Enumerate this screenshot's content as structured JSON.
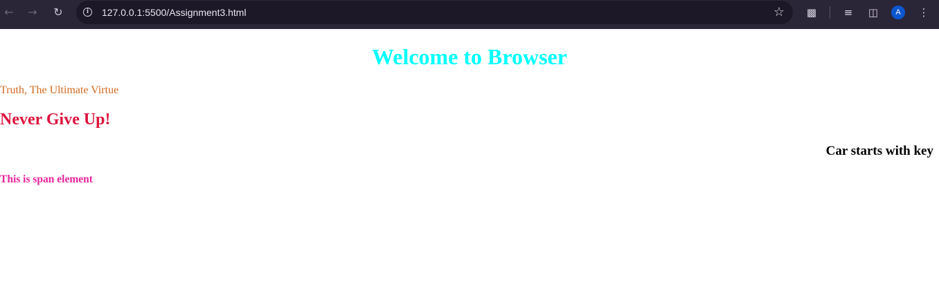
{
  "browser": {
    "url": "127.0.0.1:5500/Assignment3.html",
    "avatar_initial": "A",
    "icons": {
      "back": "back-arrow-icon",
      "forward": "forward-arrow-icon",
      "reload": "reload-icon",
      "site_info": "info-icon",
      "bookmark": "star-icon",
      "extensions": "puzzle-icon",
      "reading_list": "reading-list-icon",
      "side_panel": "side-panel-icon",
      "menu": "kebab-menu-icon"
    }
  },
  "page": {
    "heading": "Welcome to Browser",
    "virtue_text": "Truth, The Ultimate Virtue",
    "never_give_up": "Never Give Up!",
    "car_text": "Car starts with key",
    "span_text": "This is span element"
  },
  "colors": {
    "heading": "#00ffff",
    "virtue_text": "#d2691e",
    "never_give_up": "#dc143c",
    "car_text": "#000000",
    "span_text": "#e8239b",
    "browser_bar": "#2b2538",
    "omnibox": "#1c1827",
    "avatar": "#0b57d0"
  }
}
